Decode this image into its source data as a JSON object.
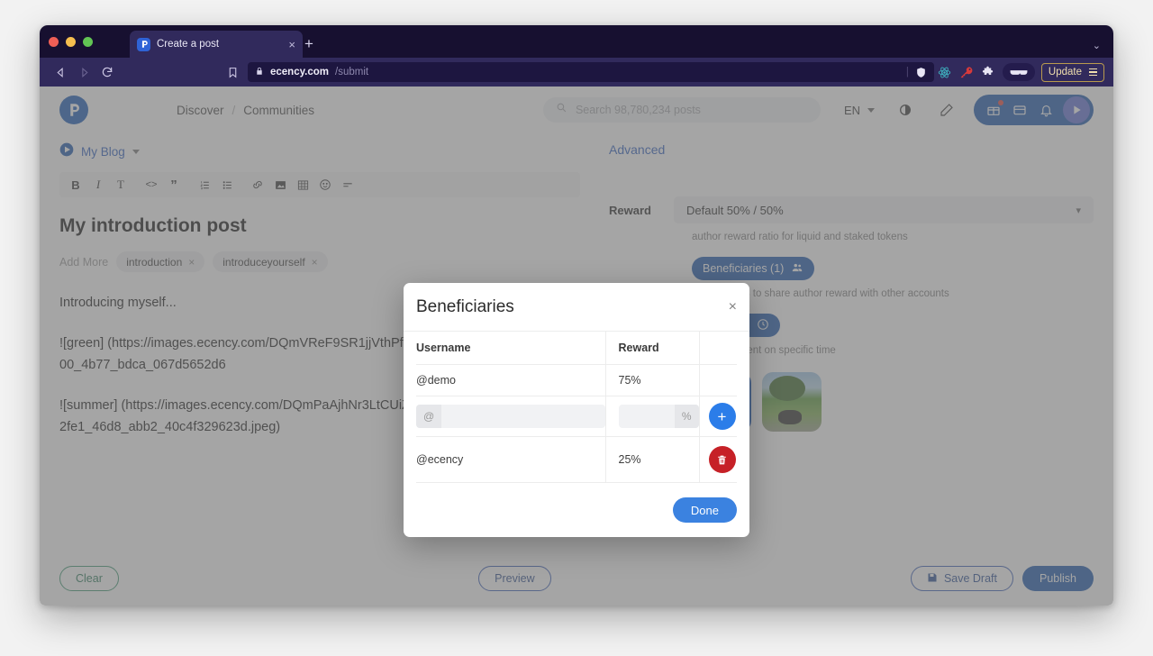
{
  "browser": {
    "tab_title": "Create a post",
    "tab_close": "×",
    "new_tab": "+",
    "url_host": "ecency.com",
    "url_path": "/submit",
    "update_label": "Update",
    "window_chevron": "⌄"
  },
  "site_header": {
    "nav": {
      "discover": "Discover",
      "separator": "/",
      "communities": "Communities"
    },
    "search_placeholder": "Search 98,780,234 posts",
    "language": "EN"
  },
  "editor": {
    "blog_selector": "My Blog",
    "toolbar": [
      {
        "name": "bold",
        "glyph": "B"
      },
      {
        "name": "italic",
        "glyph": "I"
      },
      {
        "name": "text",
        "glyph": "T"
      },
      {
        "name": "code",
        "glyph": "<>"
      },
      {
        "name": "quote",
        "glyph": "”"
      },
      {
        "name": "ordered-list",
        "glyph": "≣"
      },
      {
        "name": "unordered-list",
        "glyph": "≡"
      },
      {
        "name": "link",
        "glyph": "⚗"
      },
      {
        "name": "image",
        "glyph": "▣"
      },
      {
        "name": "table",
        "glyph": "▦"
      },
      {
        "name": "emoji",
        "glyph": "☺"
      },
      {
        "name": "horizontal-rule",
        "glyph": "="
      }
    ],
    "title": "My introduction post",
    "add_more": "Add More",
    "tags": [
      "introduction",
      "introduceyourself"
    ],
    "tag_remove": "×",
    "body_paragraphs": [
      "Introducing myself...",
      "![green] (https://images.ecency.com/DQmVReF9SR1jjVthPf14N kpTqS2nJe/1eacaf67_7800_4b77_bdca_067d5652d6",
      "![summer] (https://images.ecency.com/DQmPaAjhNr3LtCUiZw2U Ch7jo3hLQE/5e5ee3f9_2fe1_46d8_abb2_40c4f329623d.jpeg)"
    ]
  },
  "sidebar": {
    "advanced": "Advanced",
    "reward_label": "Reward",
    "reward_value": "Default 50% / 50%",
    "reward_hint": "author reward ratio for liquid and staked tokens",
    "beneficiaries_chip": "Beneficiaries (1)",
    "beneficiaries_hint": "beneficiaries to share author reward with other accounts",
    "schedule_chip": "Schedule",
    "schedule_hint": "publish content on specific time"
  },
  "footer": {
    "clear": "Clear",
    "preview": "Preview",
    "save_draft": "Save Draft",
    "publish": "Publish"
  },
  "modal": {
    "title": "Beneficiaries",
    "close": "×",
    "columns": {
      "username": "Username",
      "reward": "Reward"
    },
    "rows": [
      {
        "username": "@demo",
        "reward": "75%",
        "action": "none"
      },
      {
        "username": "@ecency",
        "reward": "25%",
        "action": "delete"
      }
    ],
    "input_row": {
      "username_prefix": "@",
      "username_value": "",
      "username_placeholder": "",
      "reward_value": "",
      "reward_placeholder": "",
      "percent_suffix": "%",
      "add_label": "+"
    },
    "done_label": "Done"
  },
  "colors": {
    "chrome_titlebar": "#171030",
    "chrome_toolbar": "#312a5c",
    "brand_blue": "#1b57ad",
    "link_blue": "#2e5fc0",
    "add_blue": "#2b7de9",
    "delete_red": "#c62127",
    "clear_green": "#2d7d5c",
    "update_gold": "#b99a4e"
  }
}
